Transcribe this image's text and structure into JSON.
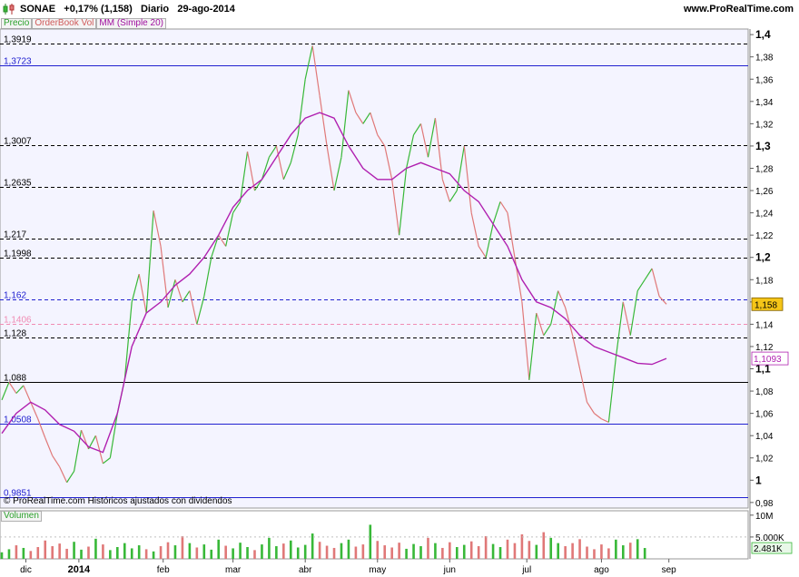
{
  "header": {
    "title": "SONAE   +0,17% (1,158)   Diario   29-ago-2014",
    "site": "www.ProRealTime.com"
  },
  "legend": {
    "price": "Precio",
    "orderbook": "OrderBook Vol",
    "ma": "MM (Simple 20)",
    "volume": "Volumen"
  },
  "copyright": "© ProRealTime.com  Históricos ajustados con dividendos",
  "colors": {
    "up": "#38b838",
    "down": "#e07878",
    "ma": "#b020b0",
    "dashed_level": "#000000",
    "blue_level": "#2020d0",
    "pink_level": "#f08cb4",
    "plot_bg": "#f4f4ff",
    "last_price_bg": "#f5c518"
  },
  "chart_data": {
    "type": "line",
    "ylim": [
      0.975,
      1.405
    ],
    "y_ticks": [
      "1,4",
      "1,38",
      "1,36",
      "1,34",
      "1,32",
      "1,3",
      "1,28",
      "1,26",
      "1,24",
      "1,22",
      "1,2",
      "1,18",
      "1,16",
      "1,14",
      "1,12",
      "1,1",
      "1,08",
      "1,06",
      "1,04",
      "1,02",
      "1",
      "0,98"
    ],
    "y_tick_values": [
      1.4,
      1.38,
      1.36,
      1.34,
      1.32,
      1.3,
      1.28,
      1.26,
      1.24,
      1.22,
      1.2,
      1.18,
      1.16,
      1.14,
      1.12,
      1.1,
      1.08,
      1.06,
      1.04,
      1.02,
      1.0,
      0.98
    ],
    "y_ticks_bold": [
      1.4,
      1.3,
      1.2,
      1.1,
      1.0
    ],
    "x_tick_labels": [
      "dic",
      "2014",
      "feb",
      "mar",
      "abr",
      "may",
      "jun",
      "jul",
      "ago",
      "sep"
    ],
    "x_tick_positions": [
      10,
      32,
      67,
      96,
      126,
      156,
      186,
      218,
      249,
      277
    ],
    "x_ticks_bold": [
      "2014"
    ],
    "x_range": [
      0,
      279
    ],
    "levels": [
      {
        "label": "1,3919",
        "value": 1.3919,
        "style": "dashed"
      },
      {
        "label": "1,3723",
        "value": 1.3723,
        "style": "blue"
      },
      {
        "label": "1,3007",
        "value": 1.3007,
        "style": "dashed"
      },
      {
        "label": "1,2635",
        "value": 1.2635,
        "style": "dashed"
      },
      {
        "label": "1,217",
        "value": 1.217,
        "style": "dashed"
      },
      {
        "label": "1,1998",
        "value": 1.1998,
        "style": "dashed"
      },
      {
        "label": "1,162",
        "value": 1.162,
        "style": "bluedash"
      },
      {
        "label": "1,1406",
        "value": 1.1406,
        "style": "pink"
      },
      {
        "label": "1,128",
        "value": 1.128,
        "style": "dashed"
      },
      {
        "label": "1,088",
        "value": 1.088,
        "style": "solidblack"
      },
      {
        "label": "1,0508",
        "value": 1.0508,
        "style": "blue"
      },
      {
        "label": "0,9851",
        "value": 0.9851,
        "style": "blue"
      }
    ],
    "last_price": {
      "label": "1,158",
      "value": 1.158
    },
    "ma_last": {
      "label": "1,1093",
      "value": 1.1093
    },
    "price_series": {
      "name": "Precio",
      "x": [
        0,
        3,
        6,
        9,
        12,
        15,
        18,
        21,
        24,
        27,
        30,
        33,
        36,
        39,
        42,
        45,
        48,
        51,
        54,
        57,
        60,
        63,
        66,
        69,
        72,
        75,
        78,
        81,
        84,
        87,
        90,
        93,
        96,
        99,
        102,
        105,
        108,
        111,
        114,
        117,
        120,
        123,
        126,
        129,
        132,
        135,
        138,
        141,
        144,
        147,
        150,
        153,
        156,
        159,
        162,
        165,
        168,
        171,
        174,
        177,
        180,
        183,
        186,
        189,
        192,
        195,
        198,
        201,
        204,
        207,
        210,
        213,
        216,
        219,
        222,
        225,
        228,
        231,
        234,
        237,
        240,
        243,
        246,
        249,
        252,
        255,
        258,
        261,
        264,
        267,
        270,
        273,
        276
      ],
      "y": [
        1.072,
        1.088,
        1.078,
        1.085,
        1.07,
        1.055,
        1.038,
        1.022,
        1.012,
        0.998,
        1.008,
        1.045,
        1.028,
        1.04,
        1.015,
        1.02,
        1.06,
        1.09,
        1.16,
        1.185,
        1.15,
        1.242,
        1.21,
        1.155,
        1.18,
        1.16,
        1.17,
        1.14,
        1.165,
        1.2,
        1.22,
        1.21,
        1.24,
        1.25,
        1.295,
        1.26,
        1.27,
        1.29,
        1.3,
        1.27,
        1.285,
        1.31,
        1.36,
        1.39,
        1.345,
        1.3,
        1.26,
        1.29,
        1.35,
        1.33,
        1.32,
        1.33,
        1.31,
        1.3,
        1.27,
        1.22,
        1.28,
        1.31,
        1.32,
        1.29,
        1.325,
        1.27,
        1.25,
        1.26,
        1.3,
        1.24,
        1.21,
        1.2,
        1.23,
        1.25,
        1.24,
        1.2,
        1.16,
        1.09,
        1.15,
        1.13,
        1.14,
        1.17,
        1.155,
        1.13,
        1.1,
        1.07,
        1.06,
        1.055,
        1.052,
        1.11,
        1.16,
        1.13,
        1.17,
        1.18,
        1.19,
        1.165,
        1.158
      ]
    },
    "ma_series": {
      "name": "MM (Simple 20)",
      "x": [
        0,
        6,
        12,
        18,
        24,
        30,
        36,
        42,
        48,
        54,
        60,
        66,
        72,
        78,
        84,
        90,
        96,
        102,
        108,
        114,
        120,
        126,
        132,
        138,
        144,
        150,
        156,
        162,
        168,
        174,
        180,
        186,
        192,
        198,
        204,
        210,
        216,
        222,
        228,
        234,
        240,
        246,
        252,
        258,
        264,
        270,
        276
      ],
      "y": [
        1.042,
        1.06,
        1.07,
        1.063,
        1.05,
        1.044,
        1.03,
        1.025,
        1.06,
        1.12,
        1.15,
        1.16,
        1.175,
        1.185,
        1.2,
        1.22,
        1.245,
        1.26,
        1.27,
        1.29,
        1.31,
        1.325,
        1.33,
        1.325,
        1.3,
        1.28,
        1.27,
        1.27,
        1.28,
        1.285,
        1.28,
        1.275,
        1.26,
        1.25,
        1.23,
        1.21,
        1.18,
        1.16,
        1.155,
        1.145,
        1.13,
        1.12,
        1.115,
        1.11,
        1.105,
        1.104,
        1.1093
      ]
    },
    "volume": {
      "y_ticks": [
        "10M",
        "5.000K"
      ],
      "y_tick_values": [
        10000,
        5000
      ],
      "last_label": "2.481K",
      "last_value": 2481,
      "ylim": [
        0,
        11000
      ],
      "x_step": 3,
      "values": [
        1500,
        2200,
        3100,
        2500,
        1800,
        2700,
        4200,
        2900,
        3500,
        2300,
        3900,
        2100,
        2800,
        4600,
        3300,
        2000,
        2700,
        3600,
        2400,
        3100,
        2200,
        1700,
        2900,
        3800,
        3100,
        5200,
        3600,
        2600,
        3300,
        2100,
        4400,
        3000,
        2400,
        3700,
        2700,
        2000,
        3300,
        4800,
        2900,
        3500,
        4200,
        2600,
        3200,
        5800,
        3900,
        3000,
        2500,
        3600,
        4400,
        2800,
        3300,
        7800,
        4100,
        3100,
        2600,
        3700,
        2300,
        3400,
        2900,
        4800,
        3600,
        2500,
        3800,
        2700,
        3200,
        4000,
        2900,
        5200,
        3400,
        2700,
        4400,
        3600,
        5600,
        4100,
        3200,
        6100,
        4800,
        3600,
        2900,
        3600,
        4500,
        2800,
        2200,
        3300,
        2400,
        4400,
        3100,
        3700,
        4500,
        2481
      ]
    }
  }
}
